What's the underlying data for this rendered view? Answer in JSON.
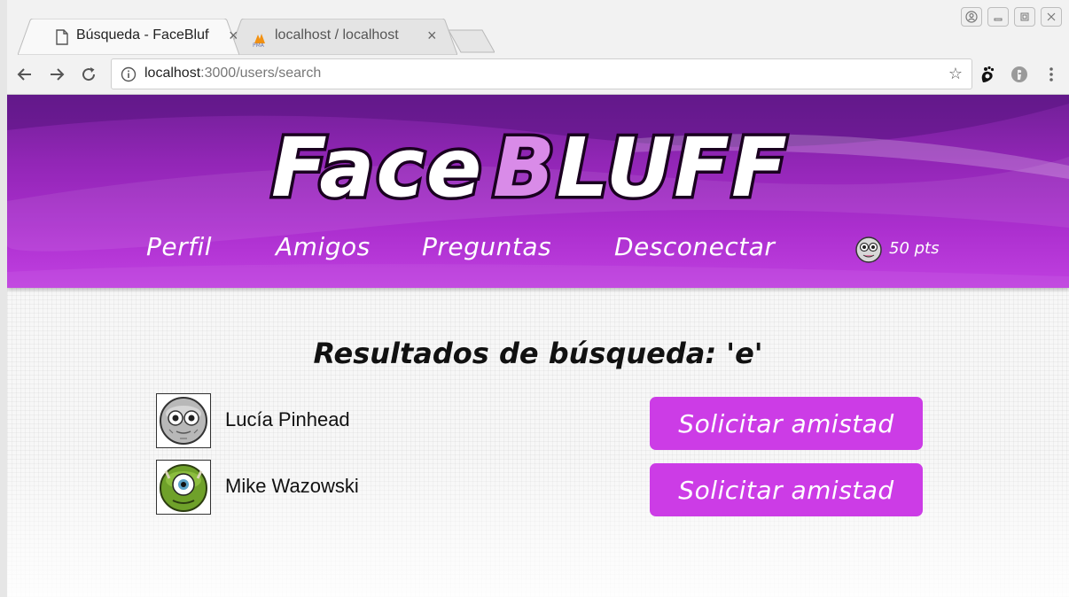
{
  "browser": {
    "tabs": [
      {
        "title": "Búsqueda - FaceBluff",
        "close": "×",
        "icon": "document-icon",
        "active": true
      },
      {
        "title": "localhost / localhost",
        "close": "×",
        "icon": "phpmyadmin-icon",
        "active": false
      }
    ],
    "address_host": "localhost",
    "address_path": ":3000/users/search"
  },
  "header": {
    "logo_text": "FaceBLUFF",
    "nav": [
      {
        "label": "Perfil"
      },
      {
        "label": "Amigos"
      },
      {
        "label": "Preguntas"
      },
      {
        "label": "Desconectar"
      }
    ],
    "points": "50 pts"
  },
  "main": {
    "heading": "Resultados de búsqueda: 'e'",
    "results": [
      {
        "name": "Lucía Pinhead",
        "action": "Solicitar amistad",
        "avatar": "grey-alien-avatar"
      },
      {
        "name": "Mike Wazowski",
        "action": "Solicitar amistad",
        "avatar": "green-cyclops-avatar"
      }
    ]
  },
  "colors": {
    "header_purple": "#9226b6",
    "button_magenta": "#cc3ce6",
    "logo_pink": "#d98be8"
  }
}
